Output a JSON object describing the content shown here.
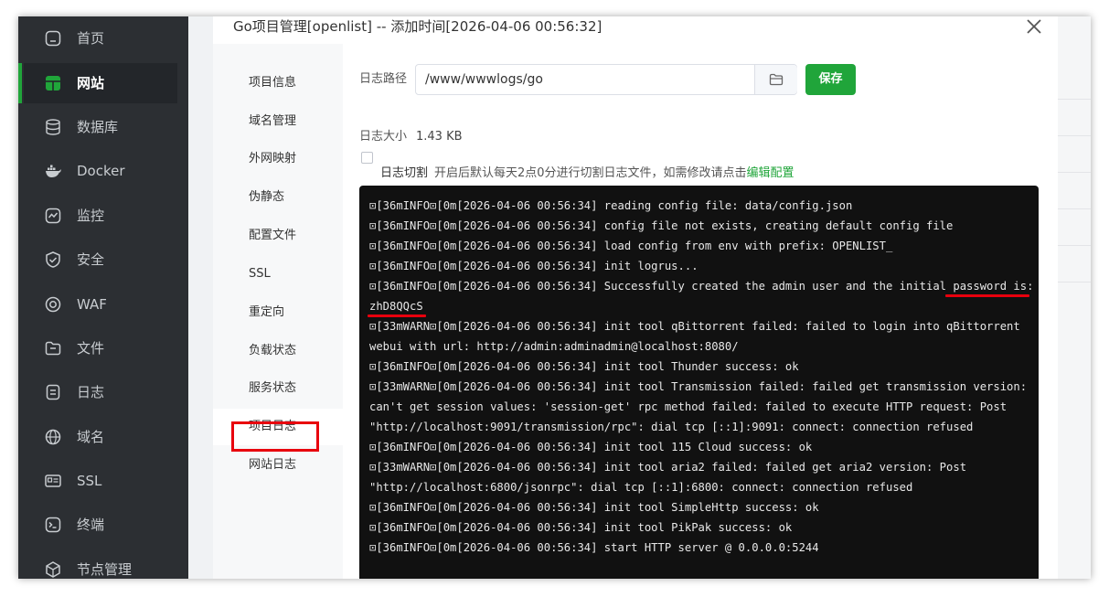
{
  "sidebar": {
    "items": [
      {
        "label": "首页",
        "icon": "home-icon"
      },
      {
        "label": "网站",
        "icon": "globe-grid-icon"
      },
      {
        "label": "数据库",
        "icon": "database-icon"
      },
      {
        "label": "Docker",
        "icon": "docker-whale-icon"
      },
      {
        "label": "监控",
        "icon": "monitor-chart-icon"
      },
      {
        "label": "安全",
        "icon": "shield-check-icon"
      },
      {
        "label": "WAF",
        "icon": "waf-globe-icon"
      },
      {
        "label": "文件",
        "icon": "folder-icon"
      },
      {
        "label": "日志",
        "icon": "log-file-icon"
      },
      {
        "label": "域名",
        "icon": "www-globe-icon"
      },
      {
        "label": "SSL",
        "icon": "ssl-card-icon"
      },
      {
        "label": "终端",
        "icon": "terminal-icon"
      },
      {
        "label": "节点管理",
        "icon": "cube-node-icon"
      }
    ],
    "active_index": 1,
    "active_color": "#20a53a"
  },
  "dialog": {
    "title": "Go项目管理[openlist] -- 添加时间[2026-04-06 00:56:32]",
    "tabs": [
      "项目信息",
      "域名管理",
      "外网映射",
      "伪静态",
      "配置文件",
      "SSL",
      "重定向",
      "负载状态",
      "服务状态",
      "项目日志",
      "网站日志"
    ],
    "active_tab_index": 9
  },
  "log": {
    "path_label": "日志路径",
    "path_value": "/www/wwwlogs/go",
    "save_label": "保存",
    "size_label": "日志大小",
    "size_value": "1.43 KB",
    "cut_label": "日志切割",
    "cut_desc": "开启后默认每天2点0分进行切割日志文件，如需修改请点击",
    "edit_link": "编辑配置",
    "cut_checked": false,
    "lines": [
      "⊡[36mINFO⊡[0m[2026-04-06 00:56:34] reading config file: data/config.json",
      "⊡[36mINFO⊡[0m[2026-04-06 00:56:34] config file not exists, creating default config file",
      "⊡[36mINFO⊡[0m[2026-04-06 00:56:34] load config from env with prefix: OPENLIST_",
      "⊡[36mINFO⊡[0m[2026-04-06 00:56:34] init logrus...",
      "⊡[36mINFO⊡[0m[2026-04-06 00:56:34] Successfully created the admin user and the initial password is:",
      "zhD8QQcS",
      "⊡[33mWARN⊡[0m[2026-04-06 00:56:34] init tool qBittorrent failed: failed to login into qBittorrent",
      "webui with url: http://admin:adminadmin@localhost:8080/",
      "⊡[36mINFO⊡[0m[2026-04-06 00:56:34] init tool Thunder success: ok",
      "⊡[33mWARN⊡[0m[2026-04-06 00:56:34] init tool Transmission failed: failed get transmission version:",
      "can't get session values: 'session-get' rpc method failed: failed to execute HTTP request: Post",
      "\"http://localhost:9091/transmission/rpc\": dial tcp [::1]:9091: connect: connection refused",
      "⊡[36mINFO⊡[0m[2026-04-06 00:56:34] init tool 115 Cloud success: ok",
      "⊡[33mWARN⊡[0m[2026-04-06 00:56:34] init tool aria2 failed: failed get aria2 version: Post",
      "\"http://localhost:6800/jsonrpc\": dial tcp [::1]:6800: connect: connection refused",
      "⊡[36mINFO⊡[0m[2026-04-06 00:56:34] init tool SimpleHttp success: ok",
      "⊡[36mINFO⊡[0m[2026-04-06 00:56:34] init tool PikPak success: ok",
      "⊡[36mINFO⊡[0m[2026-04-06 00:56:34] start HTTP server @ 0.0.0.0:5244"
    ]
  },
  "colors": {
    "brand": "#20a53a",
    "highlight": "#e8000d",
    "console_bg": "#111111",
    "sidebar_bg": "#2c2f33"
  }
}
